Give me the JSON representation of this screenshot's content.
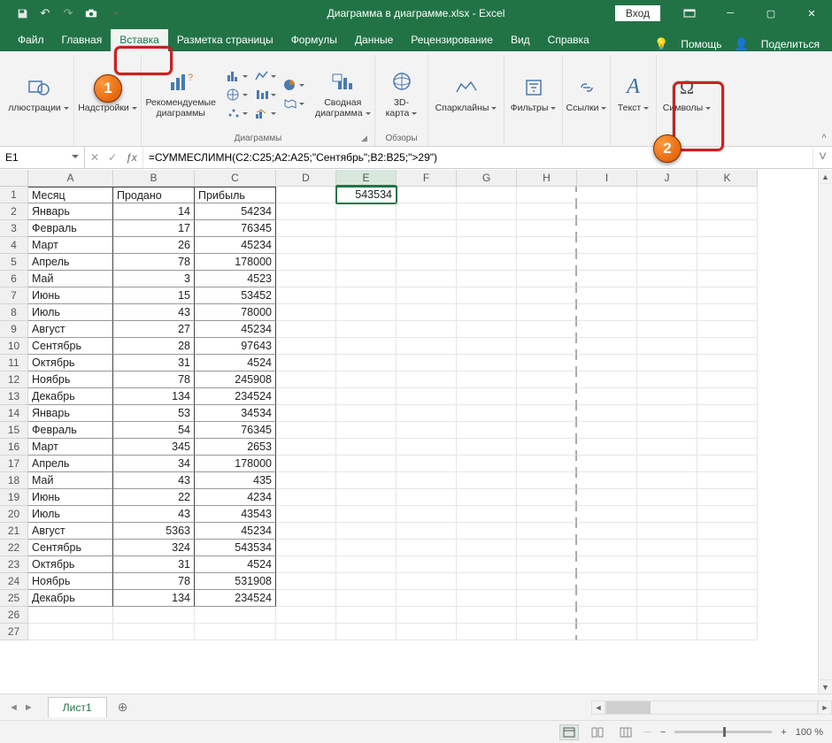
{
  "title": "Диаграмма в диаграмме.xlsx - Excel",
  "login": "Вход",
  "tabs": [
    "Файл",
    "Главная",
    "Вставка",
    "Разметка страницы",
    "Формулы",
    "Данные",
    "Рецензирование",
    "Вид",
    "Справка"
  ],
  "activeTab": 2,
  "assist": {
    "help_label": "Помощь",
    "share_label": "Поделиться"
  },
  "ribbon": {
    "illustrations": "ллюстрации",
    "addins": "Надстройки",
    "recCharts": "Рекомендуемые\nдиаграммы",
    "chartsGroup": "Диаграммы",
    "pivotChart": "Сводная\nдиаграмма",
    "map3d": "3D-\nкарта",
    "toursGroup": "Обзоры",
    "sparklines": "Спарклайны",
    "filters": "Фильтры",
    "links": "Ссылки",
    "text": "Текст",
    "symbols": "Символы"
  },
  "namebox": "E1",
  "formula": "=СУММЕСЛИМН(C2:C25;A2:A25;\"Сентябрь\";B2:B25;\">29\")",
  "columns": [
    "A",
    "B",
    "C",
    "D",
    "E",
    "F",
    "G",
    "H",
    "I",
    "J",
    "K"
  ],
  "selectedCol": "E",
  "headerRow": {
    "a": "Месяц",
    "b": "Продано",
    "c": "Прибыль",
    "e": "543534"
  },
  "rows": [
    {
      "n": 2,
      "a": "Январь",
      "b": 14,
      "c": 54234
    },
    {
      "n": 3,
      "a": "Февраль",
      "b": 17,
      "c": 76345
    },
    {
      "n": 4,
      "a": "Март",
      "b": 26,
      "c": 45234
    },
    {
      "n": 5,
      "a": "Апрель",
      "b": 78,
      "c": 178000
    },
    {
      "n": 6,
      "a": "Май",
      "b": 3,
      "c": 4523
    },
    {
      "n": 7,
      "a": "Июнь",
      "b": 15,
      "c": 53452
    },
    {
      "n": 8,
      "a": "Июль",
      "b": 43,
      "c": 78000
    },
    {
      "n": 9,
      "a": "Август",
      "b": 27,
      "c": 45234
    },
    {
      "n": 10,
      "a": "Сентябрь",
      "b": 28,
      "c": 97643
    },
    {
      "n": 11,
      "a": "Октябрь",
      "b": 31,
      "c": 4524
    },
    {
      "n": 12,
      "a": "Ноябрь",
      "b": 78,
      "c": 245908
    },
    {
      "n": 13,
      "a": "Декабрь",
      "b": 134,
      "c": 234524
    },
    {
      "n": 14,
      "a": "Январь",
      "b": 53,
      "c": 34534
    },
    {
      "n": 15,
      "a": "Февраль",
      "b": 54,
      "c": 76345
    },
    {
      "n": 16,
      "a": "Март",
      "b": 345,
      "c": 2653
    },
    {
      "n": 17,
      "a": "Апрель",
      "b": 34,
      "c": 178000
    },
    {
      "n": 18,
      "a": "Май",
      "b": 43,
      "c": 435
    },
    {
      "n": 19,
      "a": "Июнь",
      "b": 22,
      "c": 4234
    },
    {
      "n": 20,
      "a": "Июль",
      "b": 43,
      "c": 43543
    },
    {
      "n": 21,
      "a": "Август",
      "b": 5363,
      "c": 45234
    },
    {
      "n": 22,
      "a": "Сентябрь",
      "b": 324,
      "c": 543534
    },
    {
      "n": 23,
      "a": "Октябрь",
      "b": 31,
      "c": 4524
    },
    {
      "n": 24,
      "a": "Ноябрь",
      "b": 78,
      "c": 531908
    },
    {
      "n": 25,
      "a": "Декабрь",
      "b": 134,
      "c": 234524
    }
  ],
  "sheet": "Лист1",
  "zoom": "100 %"
}
